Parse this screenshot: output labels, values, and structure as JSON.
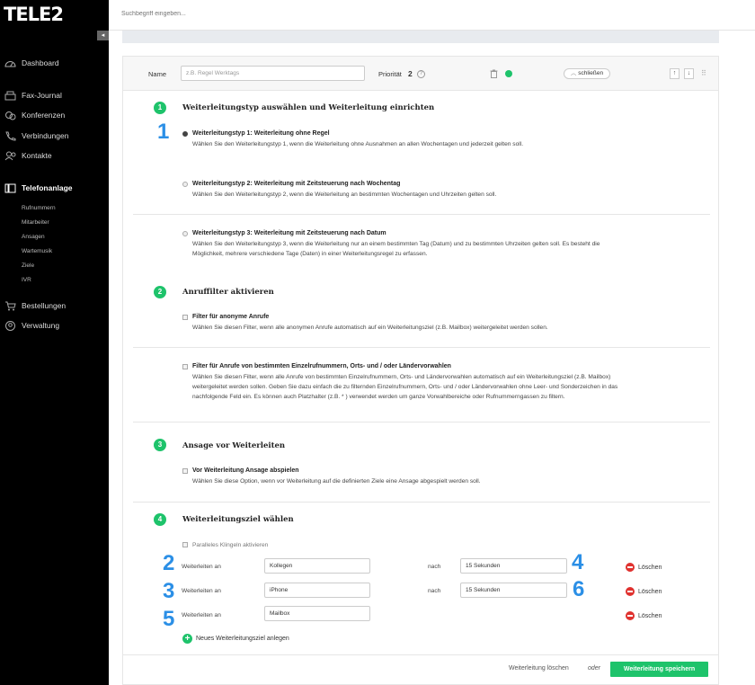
{
  "app": {
    "logo": "TELE2"
  },
  "search": {
    "placeholder": "Suchbegriff eingeben..."
  },
  "sidebar": {
    "collapse": "◂",
    "items": [
      {
        "label": "Dashboard",
        "icon": "dashboard-icon"
      },
      {
        "label": "Fax-Journal",
        "icon": "fax-icon"
      },
      {
        "label": "Konferenzen",
        "icon": "conference-icon"
      },
      {
        "label": "Verbindungen",
        "icon": "phone-icon"
      },
      {
        "label": "Kontakte",
        "icon": "contacts-icon"
      },
      {
        "label": "Telefonanlage",
        "icon": "pbx-icon",
        "active": true
      },
      {
        "label": "Bestellungen",
        "icon": "cart-icon"
      },
      {
        "label": "Verwaltung",
        "icon": "user-circle-icon"
      }
    ],
    "sub_items": [
      "Rufnummern",
      "Mitarbeiter",
      "Ansagen",
      "Wartemusik",
      "Ziele",
      "IVR"
    ]
  },
  "rule_header": {
    "name_label": "Name",
    "name_placeholder": "z.B. Regel Werktags",
    "priority_label": "Priorität",
    "priority_value": "2",
    "priority_info": "?",
    "close_label": "schließen",
    "up": "↑",
    "down": "↓",
    "drag": "⠿"
  },
  "steps": [
    {
      "number": "1",
      "title": "Weiterleitungstyp auswählen und Weiterleitung einrichten"
    },
    {
      "number": "2",
      "title": "Anruffilter aktivieren"
    },
    {
      "number": "3",
      "title": "Ansage vor Weiterleiten"
    },
    {
      "number": "4",
      "title": "Weiterleitungsziel wählen"
    }
  ],
  "types": [
    {
      "title": "Weiterleitungstyp 1: Weiterleitung ohne Regel",
      "desc": "Wählen Sie den Weiterleitungstyp 1, wenn die Weiterleitung ohne Ausnahmen an allen Wochentagen und jederzeit gelten soll.",
      "selected": true
    },
    {
      "title": "Weiterleitungstyp 2: Weiterleitung mit Zeitsteuerung nach Wochentag",
      "desc": "Wählen Sie den Weiterleitungstyp 2, wenn die Weiterleitung an bestimmten Wochentagen und Uhrzeiten gelten soll.",
      "selected": false
    },
    {
      "title": "Weiterleitungstyp 3: Weiterleitung mit Zeitsteuerung nach Datum",
      "desc1": "Wählen Sie den Weiterleitungstyp 3, wenn die Weiterleitung nur an einem bestimmten Tag (Datum) und zu bestimmten Uhrzeiten gelten soll. Es besteht die",
      "desc2": "Möglichkeit, mehrere verschiedene Tage (Daten) in einer Weiterleitungsregel zu erfassen.",
      "selected": false
    }
  ],
  "filters": [
    {
      "title": "Filter für anonyme Anrufe",
      "desc": "Wählen Sie diesen Filter, wenn alle anonymen Anrufe automatisch auf ein Weiterleitungsziel (z.B. Mailbox) weitergeleitet werden sollen."
    },
    {
      "title": "Filter für Anrufe von bestimmten Einzelrufnummern, Orts- und / oder Ländervorwahlen",
      "desc1": "Wählen Sie diesen Filter, wenn alle Anrufe von bestimmten Einzelrufnummern, Orts- und Ländervorwahlen automatisch auf ein Weiterleitungsziel (z.B. Mailbox)",
      "desc2": "weitergeleitet werden sollen. Geben Sie dazu einfach die zu filternden Einzelrufnummern, Orts- und / oder Ländervorwahlen ohne Leer- und Sonderzeichen in das",
      "desc3": "nachfolgende Feld ein. Es können auch Platzhalter (z.B. * ) verwendet werden um ganze Vorwahlbereiche oder Rufnummerngassen zu filtern."
    }
  ],
  "announcement": {
    "title": "Vor Weiterleitung Ansage abspielen",
    "desc": "Wählen Sie diese Option, wenn vor Weiterleitung auf die definierten Ziele eine Ansage abgespielt werden soll."
  },
  "targets": {
    "parallel_label": "Paralleles Klingeln aktivieren",
    "rows": [
      {
        "label": "Weiterleiten an",
        "target": "Kollegen",
        "after_label": "nach",
        "delay": "15 Sekunden",
        "delete": "Löschen"
      },
      {
        "label": "Weiterleiten an",
        "target": "iPhone",
        "after_label": "nach",
        "delay": "15 Sekunden",
        "delete": "Löschen"
      },
      {
        "label": "Weiterleiten an",
        "target": "Mailbox",
        "delete": "Löschen"
      }
    ],
    "add_label": "Neues Weiterleitungsziel anlegen"
  },
  "callouts": [
    "1",
    "2",
    "3",
    "4",
    "5",
    "6"
  ],
  "footer": {
    "delete_label": "Weiterleitung löschen",
    "or_label": "oder",
    "save_label": "Weiterleitung speichern"
  },
  "colors": {
    "accent_green": "#1ec36b",
    "callout_blue": "#2b8fe6",
    "delete_red": "#e0322f",
    "sidebar_bg": "#000000"
  }
}
